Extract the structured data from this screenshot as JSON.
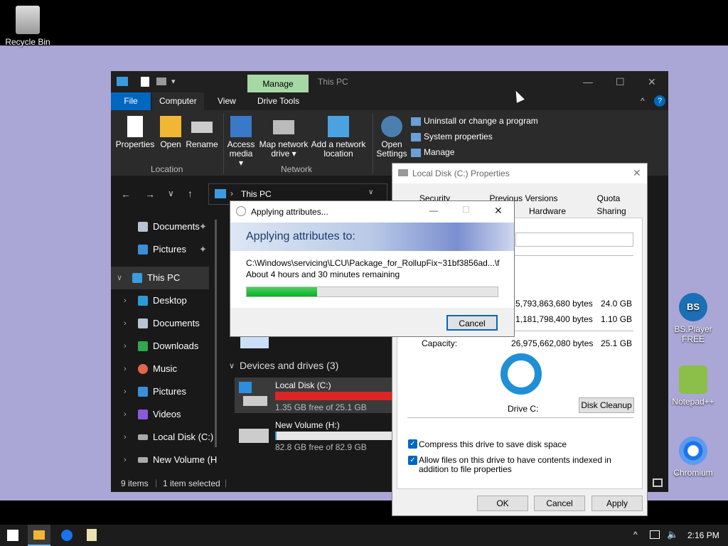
{
  "desktop": {
    "icons": [
      {
        "label": "Recycle Bin"
      },
      {
        "label": "BS.Player FREE"
      },
      {
        "label": "Notepad++"
      },
      {
        "label": "Chromium"
      }
    ]
  },
  "explorer": {
    "title": "This PC",
    "context_tab": "Manage",
    "ribbon_tabs": [
      "File",
      "Computer",
      "View",
      "Drive Tools"
    ],
    "location_group": "Location",
    "network_group": "Network",
    "buttons": {
      "properties": "Properties",
      "open": "Open",
      "rename": "Rename",
      "access_media_1": "Access",
      "access_media_2": "media ▾",
      "map_drive_1": "Map network",
      "map_drive_2": "drive ▾",
      "add_location_1": "Add a network",
      "add_location_2": "location",
      "open_settings_1": "Open",
      "open_settings_2": "Settings"
    },
    "system_links": [
      "Uninstall or change a program",
      "System properties",
      "Manage"
    ],
    "address": "This PC",
    "nav": [
      {
        "label": "Documents"
      },
      {
        "label": "Pictures"
      },
      {
        "label": "This PC"
      },
      {
        "label": "Desktop"
      },
      {
        "label": "Documents"
      },
      {
        "label": "Downloads"
      },
      {
        "label": "Music"
      },
      {
        "label": "Pictures"
      },
      {
        "label": "Videos"
      },
      {
        "label": "Local Disk (C:)"
      },
      {
        "label": "New Volume (H"
      }
    ],
    "devices_header": "Devices and drives (3)",
    "drives": [
      {
        "name": "Local Disk (C:)",
        "free": "1.35 GB free of 25.1 GB",
        "used_fraction": 0.95
      },
      {
        "name": "New Volume (H:)",
        "free": "82.8 GB free of 82.9 GB",
        "used_fraction": 0.01
      }
    ],
    "status_items": "9 items",
    "status_selected": "1 item selected"
  },
  "properties": {
    "title": "Local Disk (C:) Properties",
    "tabs_row1": [
      "Security",
      "Previous Versions",
      "Quota"
    ],
    "tabs_row2": [
      "Hardware",
      "Sharing"
    ],
    "used_bytes": "5,793,863,680 bytes",
    "used_gb": "24.0 GB",
    "free_bytes": "1,181,798,400 bytes",
    "free_gb": "1.10 GB",
    "capacity_label": "Capacity:",
    "capacity_bytes": "26,975,662,080 bytes",
    "capacity_gb": "25.1 GB",
    "drive_label": "Drive C:",
    "cleanup": "Disk Cleanup",
    "compress": "Compress this drive to save disk space",
    "index": "Allow files on this drive to have contents indexed in addition to file properties",
    "ok": "OK",
    "cancel": "Cancel",
    "apply": "Apply"
  },
  "applying": {
    "title": "Applying attributes...",
    "heading": "Applying attributes to:",
    "path": "C:\\Windows\\servicing\\LCU\\Package_for_RollupFix~31bf3856ad...\\f",
    "remaining": "About 4 hours and 30 minutes remaining",
    "progress": 0.28,
    "cancel": "Cancel"
  },
  "taskbar": {
    "time": "2:16 PM"
  }
}
